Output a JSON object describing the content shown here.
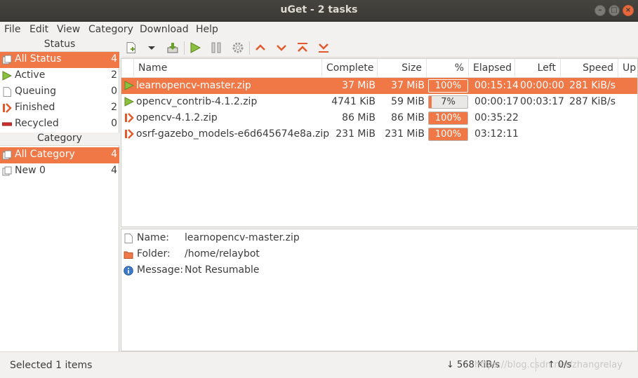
{
  "window": {
    "title": "uGet - 2 tasks",
    "buttons": {
      "minimize": "–",
      "maximize": "□",
      "close": "×"
    }
  },
  "menu": [
    "File",
    "Edit",
    "View",
    "Category",
    "Download",
    "Help"
  ],
  "sidebar": {
    "status_header": "Status",
    "status_items": [
      {
        "label": "All Status",
        "count": "4",
        "icon": "all-status-icon"
      },
      {
        "label": "Active",
        "count": "2",
        "icon": "play-icon"
      },
      {
        "label": "Queuing",
        "count": "0",
        "icon": "document-icon"
      },
      {
        "label": "Finished",
        "count": "2",
        "icon": "finished-icon"
      },
      {
        "label": "Recycled",
        "count": "0",
        "icon": "recycled-icon"
      }
    ],
    "category_header": "Category",
    "category_items": [
      {
        "label": "All Category",
        "count": "4"
      },
      {
        "label": "New 0",
        "count": "4"
      }
    ]
  },
  "toolbar": [
    "new-download-icon",
    "dropdown-arrow-icon",
    "save-icon",
    "start-icon",
    "pause-icon",
    "properties-gear-icon",
    "move-up-icon",
    "move-down-icon",
    "move-top-icon",
    "move-bottom-icon"
  ],
  "table": {
    "headers": {
      "name": "Name",
      "complete": "Complete",
      "size": "Size",
      "percent": "%",
      "elapsed": "Elapsed",
      "left": "Left",
      "speed": "Speed",
      "up": "Up"
    },
    "rows": [
      {
        "status": "active",
        "name": "learnopencv-master.zip",
        "complete": "37 MiB",
        "size": "37 MiB",
        "percent_label": "100%",
        "progress": 1.0,
        "elapsed": "00:15:14",
        "left": "00:00:00",
        "speed": "281 KiB/s"
      },
      {
        "status": "active",
        "name": "opencv_contrib-4.1.2.zip",
        "complete": "4741 KiB",
        "size": "59 MiB",
        "percent_label": "7%",
        "progress": 0.07,
        "elapsed": "00:00:17",
        "left": "00:03:17",
        "speed": "287 KiB/s"
      },
      {
        "status": "finished",
        "name": "opencv-4.1.2.zip",
        "complete": "86 MiB",
        "size": "86 MiB",
        "percent_label": "100%",
        "progress": 1.0,
        "elapsed": "00:35:22",
        "left": "",
        "speed": ""
      },
      {
        "status": "finished",
        "name": "osrf-gazebo_models-e6d645674e8a.zip",
        "complete": "231 MiB",
        "size": "231 MiB",
        "percent_label": "100%",
        "progress": 1.0,
        "elapsed": "03:12:11",
        "left": "",
        "speed": ""
      }
    ]
  },
  "detail": {
    "name_label": "Name:",
    "name_value": "learnopencv-master.zip",
    "folder_label": "Folder:",
    "folder_value": "/home/relaybot",
    "message_label": "Message:",
    "message_value": "Not Resumable"
  },
  "status": {
    "selected": "Selected 1 items",
    "download_speed": "↓ 568 KiB/s",
    "upload_speed": "↑ 0/s",
    "watermark": "https://blog.csdn.net/zhangrelay"
  },
  "colors": {
    "accent": "#f07746",
    "play": "#7fb236",
    "finished": "#e2592b"
  }
}
